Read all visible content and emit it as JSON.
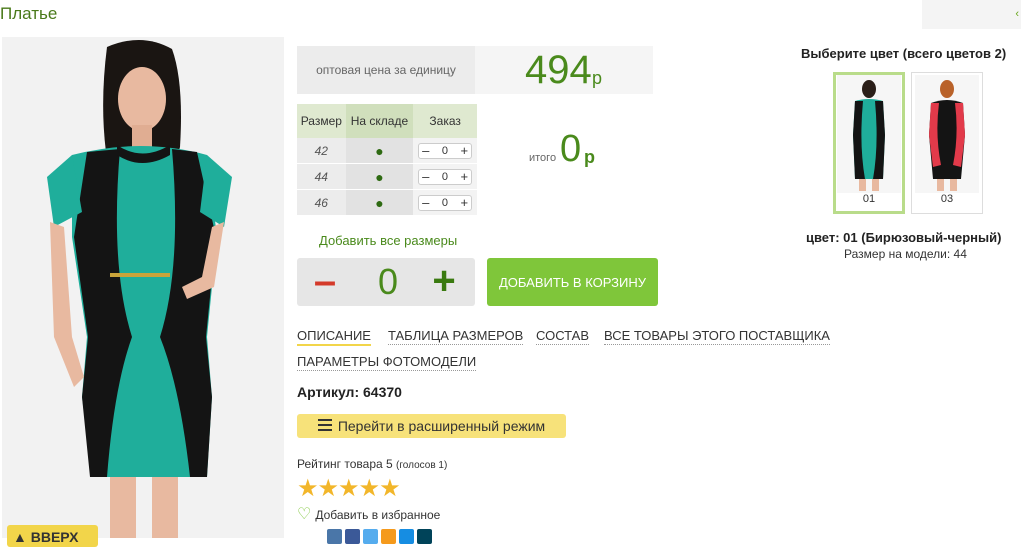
{
  "page": {
    "title": "Платье",
    "top_right_arrow": "‹"
  },
  "price": {
    "label": "оптовая цена за единицу",
    "value": "494",
    "currency": "р"
  },
  "sizes_table": {
    "headers": [
      "Размер",
      "На складе",
      "Заказ"
    ],
    "rows": [
      {
        "size": "42",
        "stock": "●",
        "qty": "0"
      },
      {
        "size": "44",
        "stock": "●",
        "qty": "0"
      },
      {
        "size": "46",
        "stock": "●",
        "qty": "0"
      }
    ],
    "stepper_minus": "–",
    "stepper_plus": "+"
  },
  "total": {
    "label": "итого",
    "value": "0",
    "currency": "р"
  },
  "add_all_sizes": "Добавить все размеры",
  "quantity": {
    "minus": "–",
    "value": "0",
    "plus": "+"
  },
  "cart_button": "ДОБАВИТЬ В КОРЗИНУ",
  "tabs": [
    {
      "label": "ОПИСАНИЕ",
      "active": true
    },
    {
      "label": "ТАБЛИЦА РАЗМЕРОВ",
      "active": false
    },
    {
      "label": "СОСТАВ",
      "active": false
    },
    {
      "label": "ВСЕ ТОВАРЫ ЭТОГО ПОСТАВЩИКА",
      "active": false
    },
    {
      "label": "ПАРАМЕТРЫ ФОТОМОДЕЛИ",
      "active": false
    }
  ],
  "article": "Артикул: 64370",
  "extended_mode_button": "Перейти в расширенный режим",
  "rating": {
    "text": "Рейтинг товара 5",
    "votes": "(голосов 1)",
    "stars": "★★★★★"
  },
  "favorite": "Добавить в избранное",
  "up_button": "▲ ВВЕРХ",
  "colors": {
    "title": "Выберите цвет (всего цветов 2)",
    "swatches": [
      {
        "num": "01",
        "selected": true
      },
      {
        "num": "03",
        "selected": false
      }
    ],
    "selected_name": "цвет: 01 (Бирюзовый-черный)",
    "model_size": "Размер на модели: 44"
  },
  "socials": [
    {
      "icon": "vk-icon",
      "color": "#4a76a8"
    },
    {
      "icon": "facebook-icon",
      "color": "#3b5998"
    },
    {
      "icon": "twitter-icon",
      "color": "#55acee"
    },
    {
      "icon": "odnoklassniki-icon",
      "color": "#f59a1c"
    },
    {
      "icon": "mailru-icon",
      "color": "#168de2"
    },
    {
      "icon": "livejournal-icon",
      "color": "#004359"
    }
  ],
  "colors_palette": {
    "accent_green": "#4a8a1c",
    "cart_button": "#7fc63a",
    "teal_dress": "#1fae9b"
  }
}
